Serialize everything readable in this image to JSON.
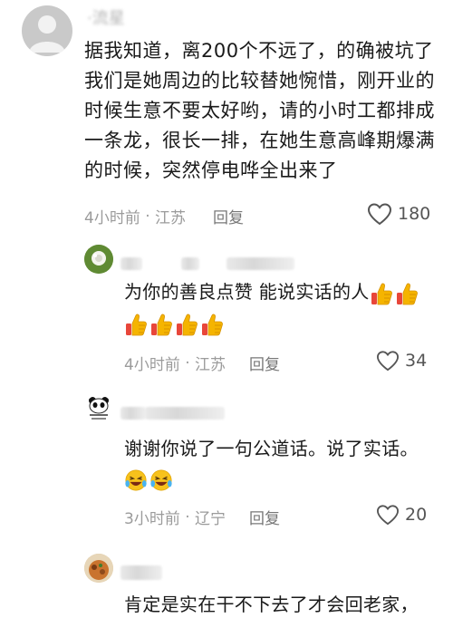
{
  "comments": [
    {
      "username": "·流星",
      "lines": [
        "据我知道，离200个不远了，的确被坑了",
        "我们是她周边的比较替她惋惜，刚开业的",
        "时候生意不要太好哟，请的小时工都排成",
        "一条龙，很长一排，在她生意高峰期爆满",
        "的时候，突然停电哗全出来了"
      ],
      "time": "4小时前",
      "location": "江苏",
      "reply_label": "回复",
      "likes": "180"
    }
  ],
  "replies": [
    {
      "text": "为你的善良点赞 能说实话的人",
      "emoji": "thumbs-up",
      "emoji_count": 6,
      "time": "4小时前",
      "location": "江苏",
      "reply_label": "回复",
      "likes": "34"
    },
    {
      "text": "谢谢你说了一句公道话。说了实话。",
      "emoji": "laughing-crying",
      "emoji_count": 2,
      "time": "3小时前",
      "location": "辽宁",
      "reply_label": "回复",
      "likes": "20"
    },
    {
      "text": "肯定是实在干不下去了才会回老家，"
    }
  ],
  "colors": {
    "meta": "#9b9b9b",
    "text": "#1a1a1a",
    "thumb": "#f5b400",
    "thumb_cuff": "#e8463a"
  }
}
